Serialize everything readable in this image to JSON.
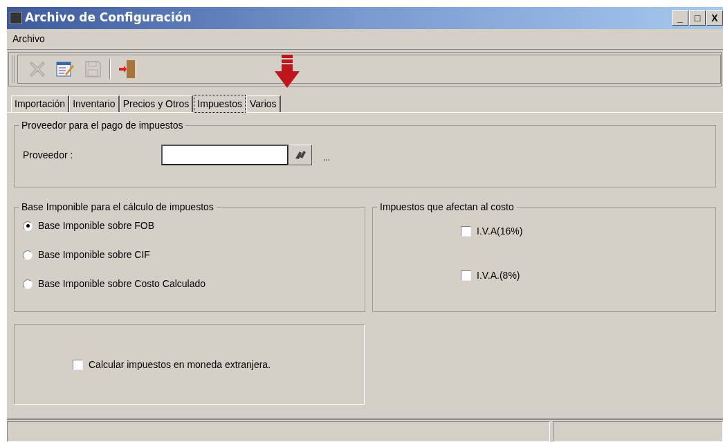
{
  "window": {
    "title": "Archivo de Configuración",
    "controls": [
      "_",
      "□",
      "X"
    ]
  },
  "menu": [
    "Archivo"
  ],
  "toolbar": [
    {
      "kind": "delete",
      "disabled": true
    },
    {
      "kind": "edit",
      "disabled": false
    },
    {
      "kind": "save",
      "disabled": true
    },
    {
      "kind": "separator"
    },
    {
      "kind": "exit",
      "disabled": false
    }
  ],
  "tabs": [
    {
      "label": "Importación",
      "selected": false
    },
    {
      "label": "Inventario",
      "selected": false
    },
    {
      "label": "Precios y Otros",
      "selected": false
    },
    {
      "label": "Impuestos",
      "selected": true
    },
    {
      "label": "Varios",
      "selected": false
    }
  ],
  "proveedor_group": {
    "title": "Proveedor para el pago de impuestos",
    "label": "Proveedor :",
    "ellipsis": "..."
  },
  "base_group": {
    "title": "Base Imponible para el cálculo de impuestos",
    "options": [
      {
        "label": "Base Imponible sobre FOB",
        "selected": true
      },
      {
        "label": "Base Imponible sobre CIF",
        "selected": false
      },
      {
        "label": "Base Imponible sobre Costo Calculado",
        "selected": false
      }
    ]
  },
  "costo_group": {
    "title": "Impuestos que afectan al costo",
    "checks": [
      {
        "label": "I.V.A(16%)",
        "checked": false
      },
      {
        "label": "I.V.A.(8%)",
        "checked": false
      }
    ]
  },
  "moneda": {
    "label": "Calcular impuestos en moneda extranjera.",
    "checked": false
  }
}
